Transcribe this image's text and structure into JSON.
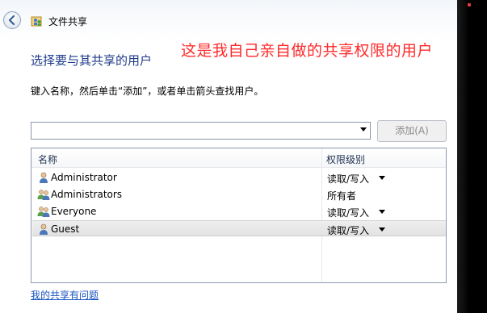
{
  "window": {
    "title": "文件共享"
  },
  "annotation": {
    "text": "这是我自己亲自做的共享权限的用户",
    "color": "#ff2a2a"
  },
  "main": {
    "heading": "选择要与其共享的用户",
    "instruction": "键入名称，然后单击“添加”，或者单击箭头查找用户。",
    "name_input": {
      "value": "",
      "placeholder": ""
    },
    "add_button_label": "添加(A)"
  },
  "table": {
    "columns": [
      "名称",
      "权限级别"
    ],
    "rows": [
      {
        "name": "Administrator",
        "icon": "user-icon",
        "permission": "读取/写入",
        "has_dropdown": true,
        "selected": false
      },
      {
        "name": "Administrators",
        "icon": "group-icon",
        "permission": "所有者",
        "has_dropdown": false,
        "selected": false
      },
      {
        "name": "Everyone",
        "icon": "group-icon",
        "permission": "读取/写入",
        "has_dropdown": true,
        "selected": false
      },
      {
        "name": "Guest",
        "icon": "user-icon",
        "permission": "读取/写入",
        "has_dropdown": true,
        "selected": true
      }
    ]
  },
  "footer": {
    "help_link": "我的共享有问题"
  },
  "colors": {
    "heading": "#1e3a8a",
    "link": "#1a55c2",
    "selected_row": "#e6e6e6"
  }
}
